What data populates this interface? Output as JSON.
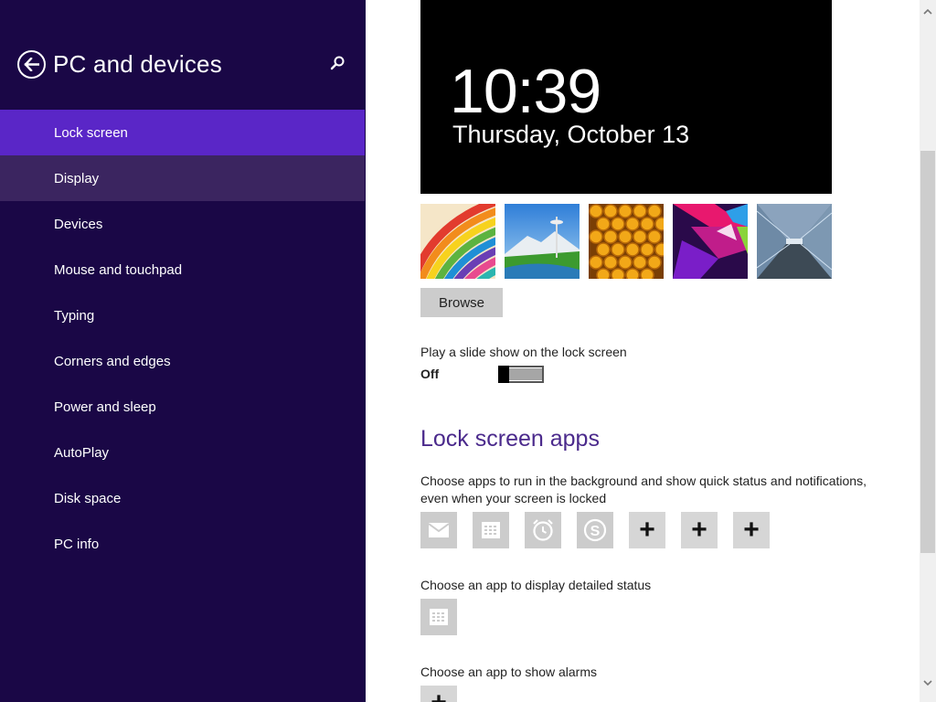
{
  "sidebar": {
    "title": "PC and devices",
    "back_icon": "back-arrow-icon",
    "search_icon": "search-icon",
    "items": [
      {
        "label": "Lock screen",
        "state": "selected"
      },
      {
        "label": "Display",
        "state": "hover"
      },
      {
        "label": "Devices"
      },
      {
        "label": "Mouse and touchpad"
      },
      {
        "label": "Typing"
      },
      {
        "label": "Corners and edges"
      },
      {
        "label": "Power and sleep"
      },
      {
        "label": "AutoPlay"
      },
      {
        "label": "Disk space"
      },
      {
        "label": "PC info"
      }
    ]
  },
  "preview": {
    "time": "10:39",
    "date": "Thursday, October 13"
  },
  "thumbnails": [
    {
      "name": "rainbow-stripes"
    },
    {
      "name": "space-needle"
    },
    {
      "name": "honeycomb"
    },
    {
      "name": "geometric-pink"
    },
    {
      "name": "tunnel-lights"
    }
  ],
  "browse_label": "Browse",
  "slideshow": {
    "label": "Play a slide show on the lock screen",
    "state": "Off"
  },
  "lock_screen_apps": {
    "title": "Lock screen apps",
    "description": "Choose apps to run in the background and show quick status and notifications, even when your screen is locked",
    "slots": [
      {
        "icon": "mail-icon"
      },
      {
        "icon": "calendar-icon"
      },
      {
        "icon": "alarm-clock-icon"
      },
      {
        "icon": "skype-icon"
      },
      {
        "icon": "plus-icon",
        "label": "+"
      },
      {
        "icon": "plus-icon",
        "label": "+"
      },
      {
        "icon": "plus-icon",
        "label": "+"
      }
    ],
    "detail_label": "Choose an app to display detailed status",
    "detail_icon": "calendar-icon",
    "alarm_label": "Choose an app to show alarms",
    "alarm_slot_label": "+"
  },
  "colors": {
    "sidebar_bg": "#1a0746",
    "selected_bg": "#5a26c7",
    "accent_title": "#4b2a8c"
  }
}
